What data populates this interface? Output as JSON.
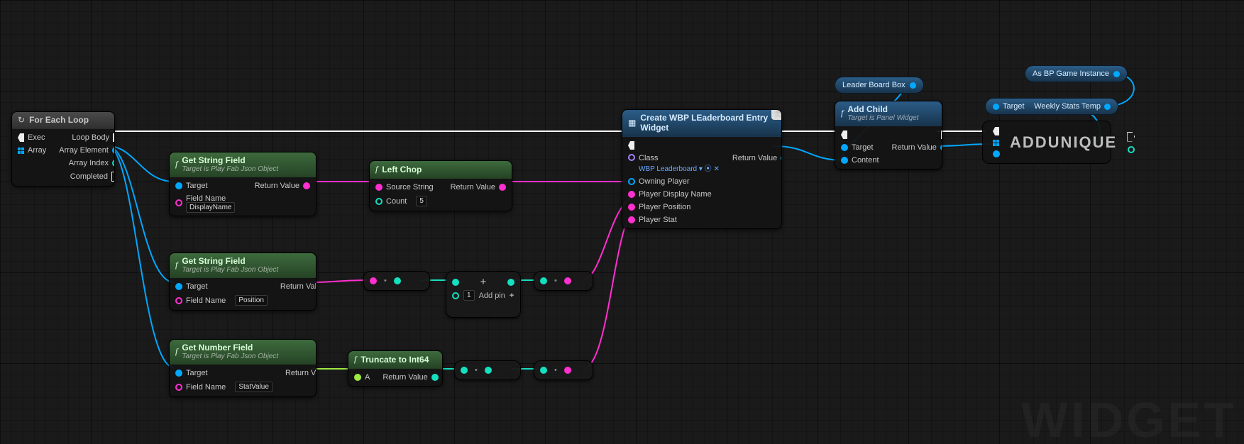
{
  "watermark": "WIDGET",
  "nodes": {
    "forEach": {
      "title": "For Each Loop",
      "execIn": "Exec",
      "arrayIn": "Array",
      "loopBody": "Loop Body",
      "arrayElement": "Array Element",
      "arrayIndex": "Array Index",
      "completed": "Completed"
    },
    "getStr1": {
      "title": "Get String Field",
      "subtitle": "Target is Play Fab Json Object",
      "target": "Target",
      "fieldName": "Field Name",
      "fieldNameVal": "DisplayName",
      "ret": "Return Value"
    },
    "leftChop": {
      "title": "Left Chop",
      "sourceStr": "Source String",
      "count": "Count",
      "countVal": "5",
      "ret": "Return Value"
    },
    "getStr2": {
      "title": "Get String Field",
      "subtitle": "Target is Play Fab Json Object",
      "target": "Target",
      "fieldName": "Field Name",
      "fieldNameVal": "Position",
      "ret": "Return Value"
    },
    "addInt": {
      "b": "1",
      "addPin": "Add pin"
    },
    "getNum": {
      "title": "Get Number Field",
      "subtitle": "Target is Play Fab Json Object",
      "target": "Target",
      "fieldName": "Field Name",
      "fieldNameVal": "StatValue",
      "ret": "Return Value"
    },
    "trunc": {
      "title": "Truncate to Int64",
      "a": "A",
      "ret": "Return Value"
    },
    "createW": {
      "title": "Create WBP LEaderboard Entry Widget",
      "class": "Class",
      "classVal": "WBP Leaderboard",
      "owning": "Owning Player",
      "pdn": "Player Display Name",
      "pp": "Player Position",
      "ps": "Player Stat",
      "ret": "Return Value"
    },
    "leaderBox": {
      "title": "Leader Board Box"
    },
    "addChild": {
      "title": "Add Child",
      "subtitle": "Target is Panel Widget",
      "target": "Target",
      "content": "Content",
      "ret": "Return Value"
    },
    "gameInst": {
      "title": "As BP Game Instance"
    },
    "weekly": {
      "target": "Target",
      "title": "Weekly Stats Temp"
    },
    "addUnique": {
      "title": "ADDUNIQUE"
    }
  }
}
